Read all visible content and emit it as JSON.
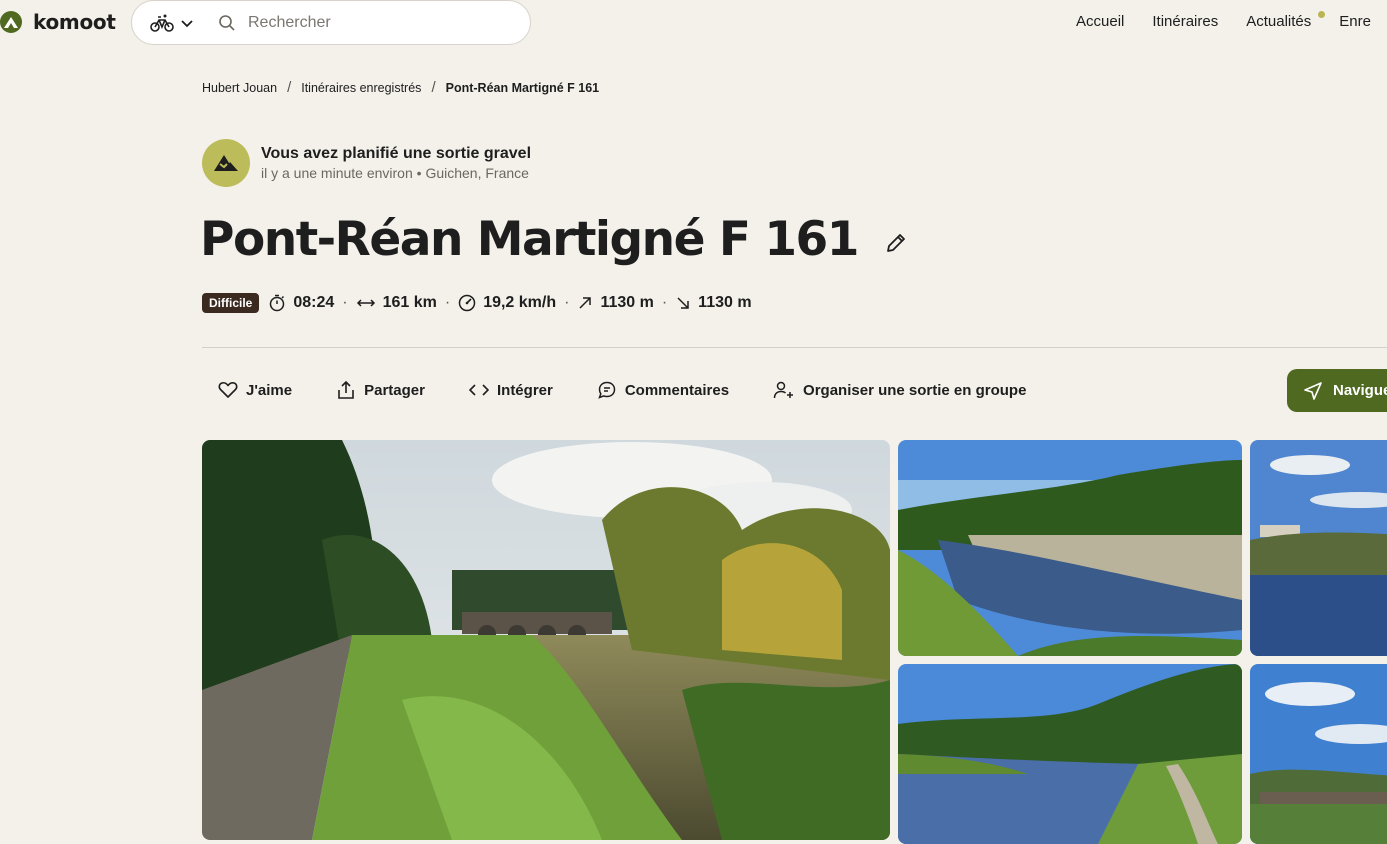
{
  "brand": {
    "name": "komoot"
  },
  "search": {
    "placeholder": "Rechercher"
  },
  "nav": {
    "items": [
      "Accueil",
      "Itinéraires",
      "Actualités",
      "Enre"
    ]
  },
  "breadcrumb": {
    "user": "Hubert Jouan",
    "section": "Itinéraires enregistrés",
    "current": "Pont-Réan Martigné F 161"
  },
  "activity": {
    "title": "Vous avez planifié une sortie gravel",
    "time": "il y a une minute environ",
    "location": "Guichen, France"
  },
  "tour": {
    "title": "Pont-Réan Martigné F 161",
    "difficulty": "Difficile",
    "duration": "08:24",
    "distance": "161 km",
    "speed": "19,2 km/h",
    "ascent": "1130 m",
    "descent": "1130 m"
  },
  "actions": {
    "like": "J'aime",
    "share": "Partager",
    "embed": "Intégrer",
    "comments": "Commentaires",
    "group": "Organiser une sortie en groupe",
    "navigate": "Navigue"
  },
  "colors": {
    "background": "#f4f1eb",
    "brand": "#4f6a20",
    "difficulty_badge": "#3a2a1f",
    "avatar": "#bdbc5a"
  }
}
